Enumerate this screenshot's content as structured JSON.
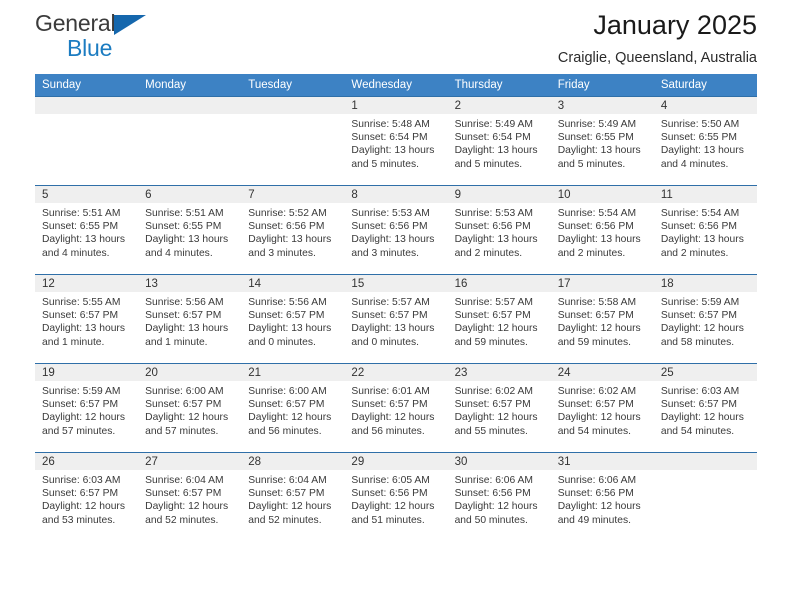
{
  "brand": {
    "name_top": "General",
    "name_bottom": "Blue",
    "accent_color": "#1567ad",
    "text_color": "#3b3b3b"
  },
  "header": {
    "title": "January 2025",
    "subtitle": "Craiglie, Queensland, Australia"
  },
  "calendar": {
    "header_bg": "#3d82c4",
    "daynum_bg": "#efefef",
    "weekdays": [
      "Sunday",
      "Monday",
      "Tuesday",
      "Wednesday",
      "Thursday",
      "Friday",
      "Saturday"
    ],
    "weeks": [
      [
        {
          "day": "",
          "empty": true,
          "sunrise": "",
          "sunset": "",
          "daylight_line1": "",
          "daylight_line2": ""
        },
        {
          "day": "",
          "empty": true,
          "sunrise": "",
          "sunset": "",
          "daylight_line1": "",
          "daylight_line2": ""
        },
        {
          "day": "",
          "empty": true,
          "sunrise": "",
          "sunset": "",
          "daylight_line1": "",
          "daylight_line2": ""
        },
        {
          "day": "1",
          "empty": false,
          "sunrise": "Sunrise: 5:48 AM",
          "sunset": "Sunset: 6:54 PM",
          "daylight_line1": "Daylight: 13 hours",
          "daylight_line2": "and 5 minutes."
        },
        {
          "day": "2",
          "empty": false,
          "sunrise": "Sunrise: 5:49 AM",
          "sunset": "Sunset: 6:54 PM",
          "daylight_line1": "Daylight: 13 hours",
          "daylight_line2": "and 5 minutes."
        },
        {
          "day": "3",
          "empty": false,
          "sunrise": "Sunrise: 5:49 AM",
          "sunset": "Sunset: 6:55 PM",
          "daylight_line1": "Daylight: 13 hours",
          "daylight_line2": "and 5 minutes."
        },
        {
          "day": "4",
          "empty": false,
          "sunrise": "Sunrise: 5:50 AM",
          "sunset": "Sunset: 6:55 PM",
          "daylight_line1": "Daylight: 13 hours",
          "daylight_line2": "and 4 minutes."
        }
      ],
      [
        {
          "day": "5",
          "empty": false,
          "sunrise": "Sunrise: 5:51 AM",
          "sunset": "Sunset: 6:55 PM",
          "daylight_line1": "Daylight: 13 hours",
          "daylight_line2": "and 4 minutes."
        },
        {
          "day": "6",
          "empty": false,
          "sunrise": "Sunrise: 5:51 AM",
          "sunset": "Sunset: 6:55 PM",
          "daylight_line1": "Daylight: 13 hours",
          "daylight_line2": "and 4 minutes."
        },
        {
          "day": "7",
          "empty": false,
          "sunrise": "Sunrise: 5:52 AM",
          "sunset": "Sunset: 6:56 PM",
          "daylight_line1": "Daylight: 13 hours",
          "daylight_line2": "and 3 minutes."
        },
        {
          "day": "8",
          "empty": false,
          "sunrise": "Sunrise: 5:53 AM",
          "sunset": "Sunset: 6:56 PM",
          "daylight_line1": "Daylight: 13 hours",
          "daylight_line2": "and 3 minutes."
        },
        {
          "day": "9",
          "empty": false,
          "sunrise": "Sunrise: 5:53 AM",
          "sunset": "Sunset: 6:56 PM",
          "daylight_line1": "Daylight: 13 hours",
          "daylight_line2": "and 2 minutes."
        },
        {
          "day": "10",
          "empty": false,
          "sunrise": "Sunrise: 5:54 AM",
          "sunset": "Sunset: 6:56 PM",
          "daylight_line1": "Daylight: 13 hours",
          "daylight_line2": "and 2 minutes."
        },
        {
          "day": "11",
          "empty": false,
          "sunrise": "Sunrise: 5:54 AM",
          "sunset": "Sunset: 6:56 PM",
          "daylight_line1": "Daylight: 13 hours",
          "daylight_line2": "and 2 minutes."
        }
      ],
      [
        {
          "day": "12",
          "empty": false,
          "sunrise": "Sunrise: 5:55 AM",
          "sunset": "Sunset: 6:57 PM",
          "daylight_line1": "Daylight: 13 hours",
          "daylight_line2": "and 1 minute."
        },
        {
          "day": "13",
          "empty": false,
          "sunrise": "Sunrise: 5:56 AM",
          "sunset": "Sunset: 6:57 PM",
          "daylight_line1": "Daylight: 13 hours",
          "daylight_line2": "and 1 minute."
        },
        {
          "day": "14",
          "empty": false,
          "sunrise": "Sunrise: 5:56 AM",
          "sunset": "Sunset: 6:57 PM",
          "daylight_line1": "Daylight: 13 hours",
          "daylight_line2": "and 0 minutes."
        },
        {
          "day": "15",
          "empty": false,
          "sunrise": "Sunrise: 5:57 AM",
          "sunset": "Sunset: 6:57 PM",
          "daylight_line1": "Daylight: 13 hours",
          "daylight_line2": "and 0 minutes."
        },
        {
          "day": "16",
          "empty": false,
          "sunrise": "Sunrise: 5:57 AM",
          "sunset": "Sunset: 6:57 PM",
          "daylight_line1": "Daylight: 12 hours",
          "daylight_line2": "and 59 minutes."
        },
        {
          "day": "17",
          "empty": false,
          "sunrise": "Sunrise: 5:58 AM",
          "sunset": "Sunset: 6:57 PM",
          "daylight_line1": "Daylight: 12 hours",
          "daylight_line2": "and 59 minutes."
        },
        {
          "day": "18",
          "empty": false,
          "sunrise": "Sunrise: 5:59 AM",
          "sunset": "Sunset: 6:57 PM",
          "daylight_line1": "Daylight: 12 hours",
          "daylight_line2": "and 58 minutes."
        }
      ],
      [
        {
          "day": "19",
          "empty": false,
          "sunrise": "Sunrise: 5:59 AM",
          "sunset": "Sunset: 6:57 PM",
          "daylight_line1": "Daylight: 12 hours",
          "daylight_line2": "and 57 minutes."
        },
        {
          "day": "20",
          "empty": false,
          "sunrise": "Sunrise: 6:00 AM",
          "sunset": "Sunset: 6:57 PM",
          "daylight_line1": "Daylight: 12 hours",
          "daylight_line2": "and 57 minutes."
        },
        {
          "day": "21",
          "empty": false,
          "sunrise": "Sunrise: 6:00 AM",
          "sunset": "Sunset: 6:57 PM",
          "daylight_line1": "Daylight: 12 hours",
          "daylight_line2": "and 56 minutes."
        },
        {
          "day": "22",
          "empty": false,
          "sunrise": "Sunrise: 6:01 AM",
          "sunset": "Sunset: 6:57 PM",
          "daylight_line1": "Daylight: 12 hours",
          "daylight_line2": "and 56 minutes."
        },
        {
          "day": "23",
          "empty": false,
          "sunrise": "Sunrise: 6:02 AM",
          "sunset": "Sunset: 6:57 PM",
          "daylight_line1": "Daylight: 12 hours",
          "daylight_line2": "and 55 minutes."
        },
        {
          "day": "24",
          "empty": false,
          "sunrise": "Sunrise: 6:02 AM",
          "sunset": "Sunset: 6:57 PM",
          "daylight_line1": "Daylight: 12 hours",
          "daylight_line2": "and 54 minutes."
        },
        {
          "day": "25",
          "empty": false,
          "sunrise": "Sunrise: 6:03 AM",
          "sunset": "Sunset: 6:57 PM",
          "daylight_line1": "Daylight: 12 hours",
          "daylight_line2": "and 54 minutes."
        }
      ],
      [
        {
          "day": "26",
          "empty": false,
          "sunrise": "Sunrise: 6:03 AM",
          "sunset": "Sunset: 6:57 PM",
          "daylight_line1": "Daylight: 12 hours",
          "daylight_line2": "and 53 minutes."
        },
        {
          "day": "27",
          "empty": false,
          "sunrise": "Sunrise: 6:04 AM",
          "sunset": "Sunset: 6:57 PM",
          "daylight_line1": "Daylight: 12 hours",
          "daylight_line2": "and 52 minutes."
        },
        {
          "day": "28",
          "empty": false,
          "sunrise": "Sunrise: 6:04 AM",
          "sunset": "Sunset: 6:57 PM",
          "daylight_line1": "Daylight: 12 hours",
          "daylight_line2": "and 52 minutes."
        },
        {
          "day": "29",
          "empty": false,
          "sunrise": "Sunrise: 6:05 AM",
          "sunset": "Sunset: 6:56 PM",
          "daylight_line1": "Daylight: 12 hours",
          "daylight_line2": "and 51 minutes."
        },
        {
          "day": "30",
          "empty": false,
          "sunrise": "Sunrise: 6:06 AM",
          "sunset": "Sunset: 6:56 PM",
          "daylight_line1": "Daylight: 12 hours",
          "daylight_line2": "and 50 minutes."
        },
        {
          "day": "31",
          "empty": false,
          "sunrise": "Sunrise: 6:06 AM",
          "sunset": "Sunset: 6:56 PM",
          "daylight_line1": "Daylight: 12 hours",
          "daylight_line2": "and 49 minutes."
        },
        {
          "day": "",
          "empty": true,
          "sunrise": "",
          "sunset": "",
          "daylight_line1": "",
          "daylight_line2": ""
        }
      ]
    ]
  }
}
